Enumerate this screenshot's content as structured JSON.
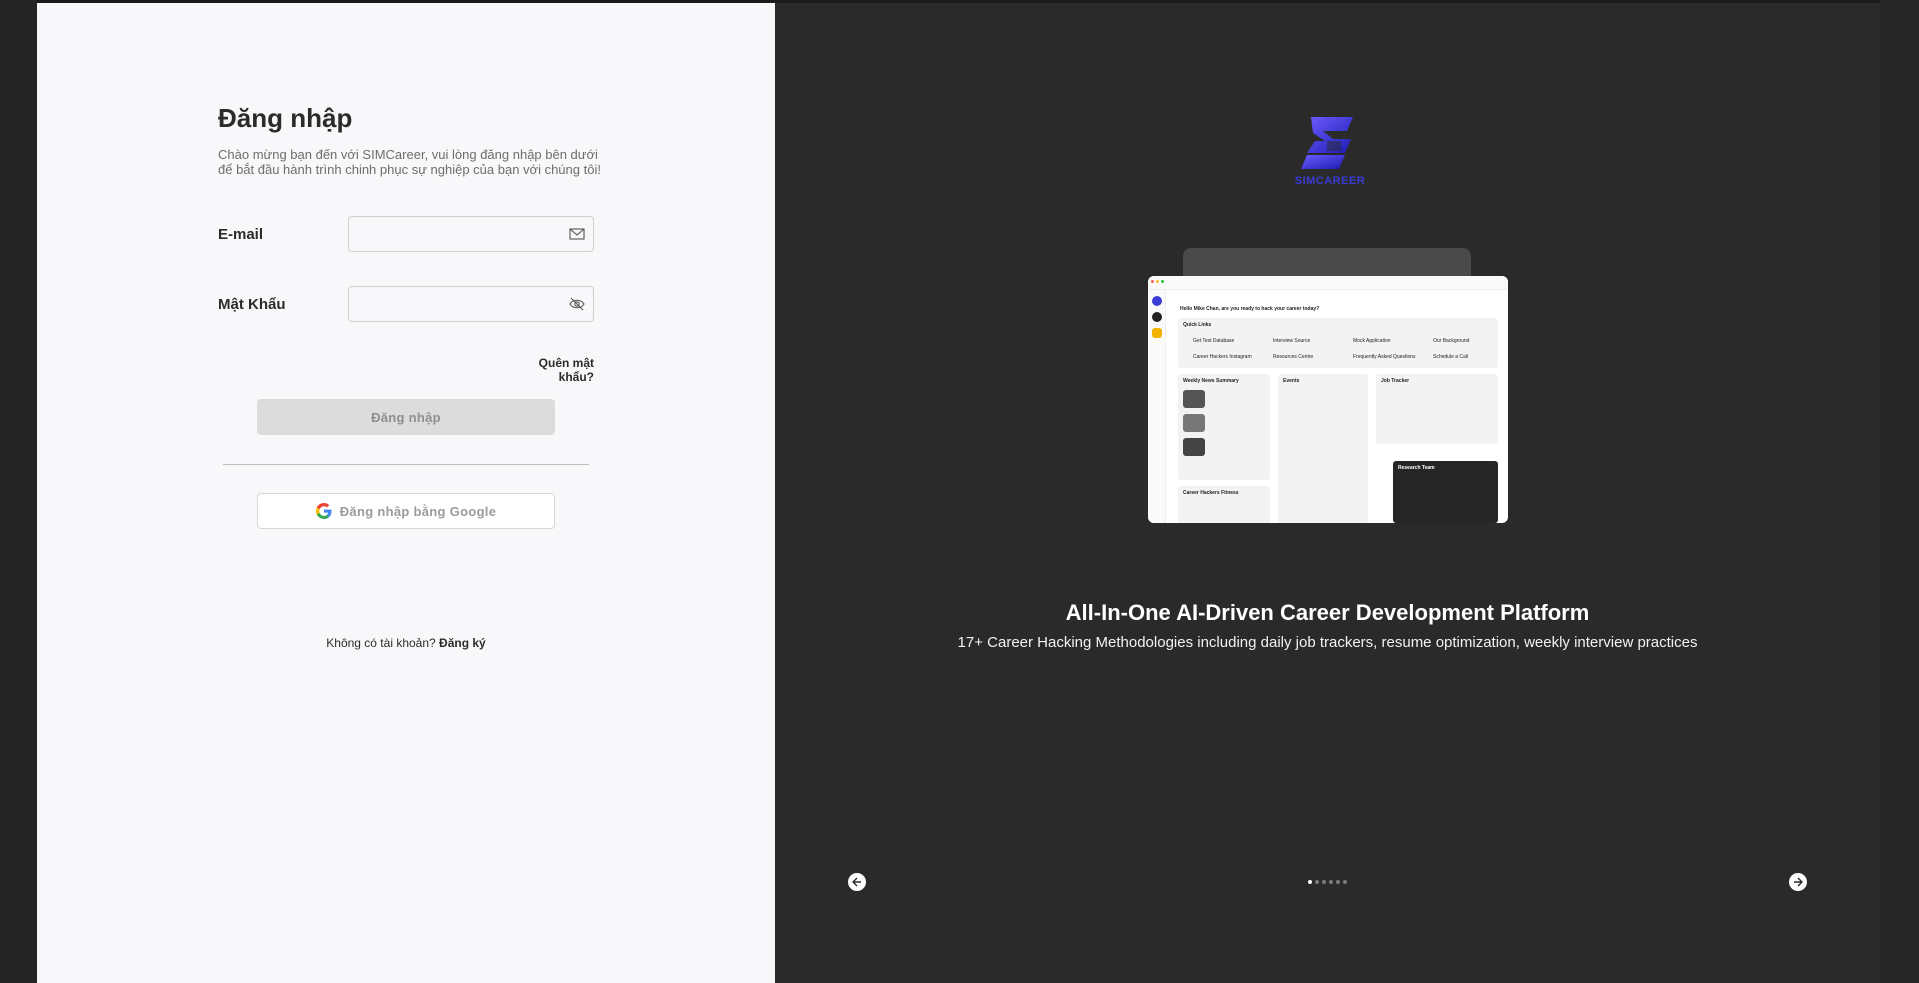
{
  "login": {
    "title": "Đăng nhập",
    "subtitle": "Chào mừng bạn đến với SIMCareer, vui lòng đăng nhập bên dưới để bắt đầu hành trình chinh phục sự nghiệp của bạn với chúng tôi!",
    "email_label": "E-mail",
    "email_value": "",
    "email_icon": "mail-icon",
    "password_label": "Mật Khẩu",
    "password_value": "",
    "password_icon": "eye-off-icon",
    "forgot_label": "Quên mật khẩu?",
    "submit_label": "Đăng nhập",
    "google_label": "Đăng nhập bằng Google",
    "google_icon": "google-icon",
    "no_account_text": "Không có tài khoản?",
    "signup_label": "Đăng ký"
  },
  "showcase": {
    "logo_text": "SIMCAREER",
    "headline": "All-In-One AI-Driven Career Development Platform",
    "subline": "17+ Career Hacking Methodologies including daily job trackers, resume optimization, weekly interview practices",
    "slides_total": 6,
    "active_slide": 1,
    "prev_icon": "arrow-left-icon",
    "next_icon": "arrow-right-icon",
    "mock": {
      "greeting": "Hello Mike Chan, are you ready to hack your career today?",
      "quick_links_title": "Quick Links",
      "quick_links": [
        "Get Test Database",
        "Interview Source",
        "Mock Application",
        "Our Background",
        "Career Hackers Instagram",
        "Resources Centre",
        "Frequently Asked Questions",
        "Schedule a Call"
      ],
      "news_title": "Weekly News Summary",
      "events_title": "Events",
      "tracker_title": "Job Tracker",
      "research_title": "Research Team",
      "fitness_title": "Career Hackers Fitness"
    }
  },
  "colors": {
    "left_bg": "#f8f8fa",
    "right_bg": "#2a2a2a",
    "logo_accent": "#3b3bd6"
  }
}
